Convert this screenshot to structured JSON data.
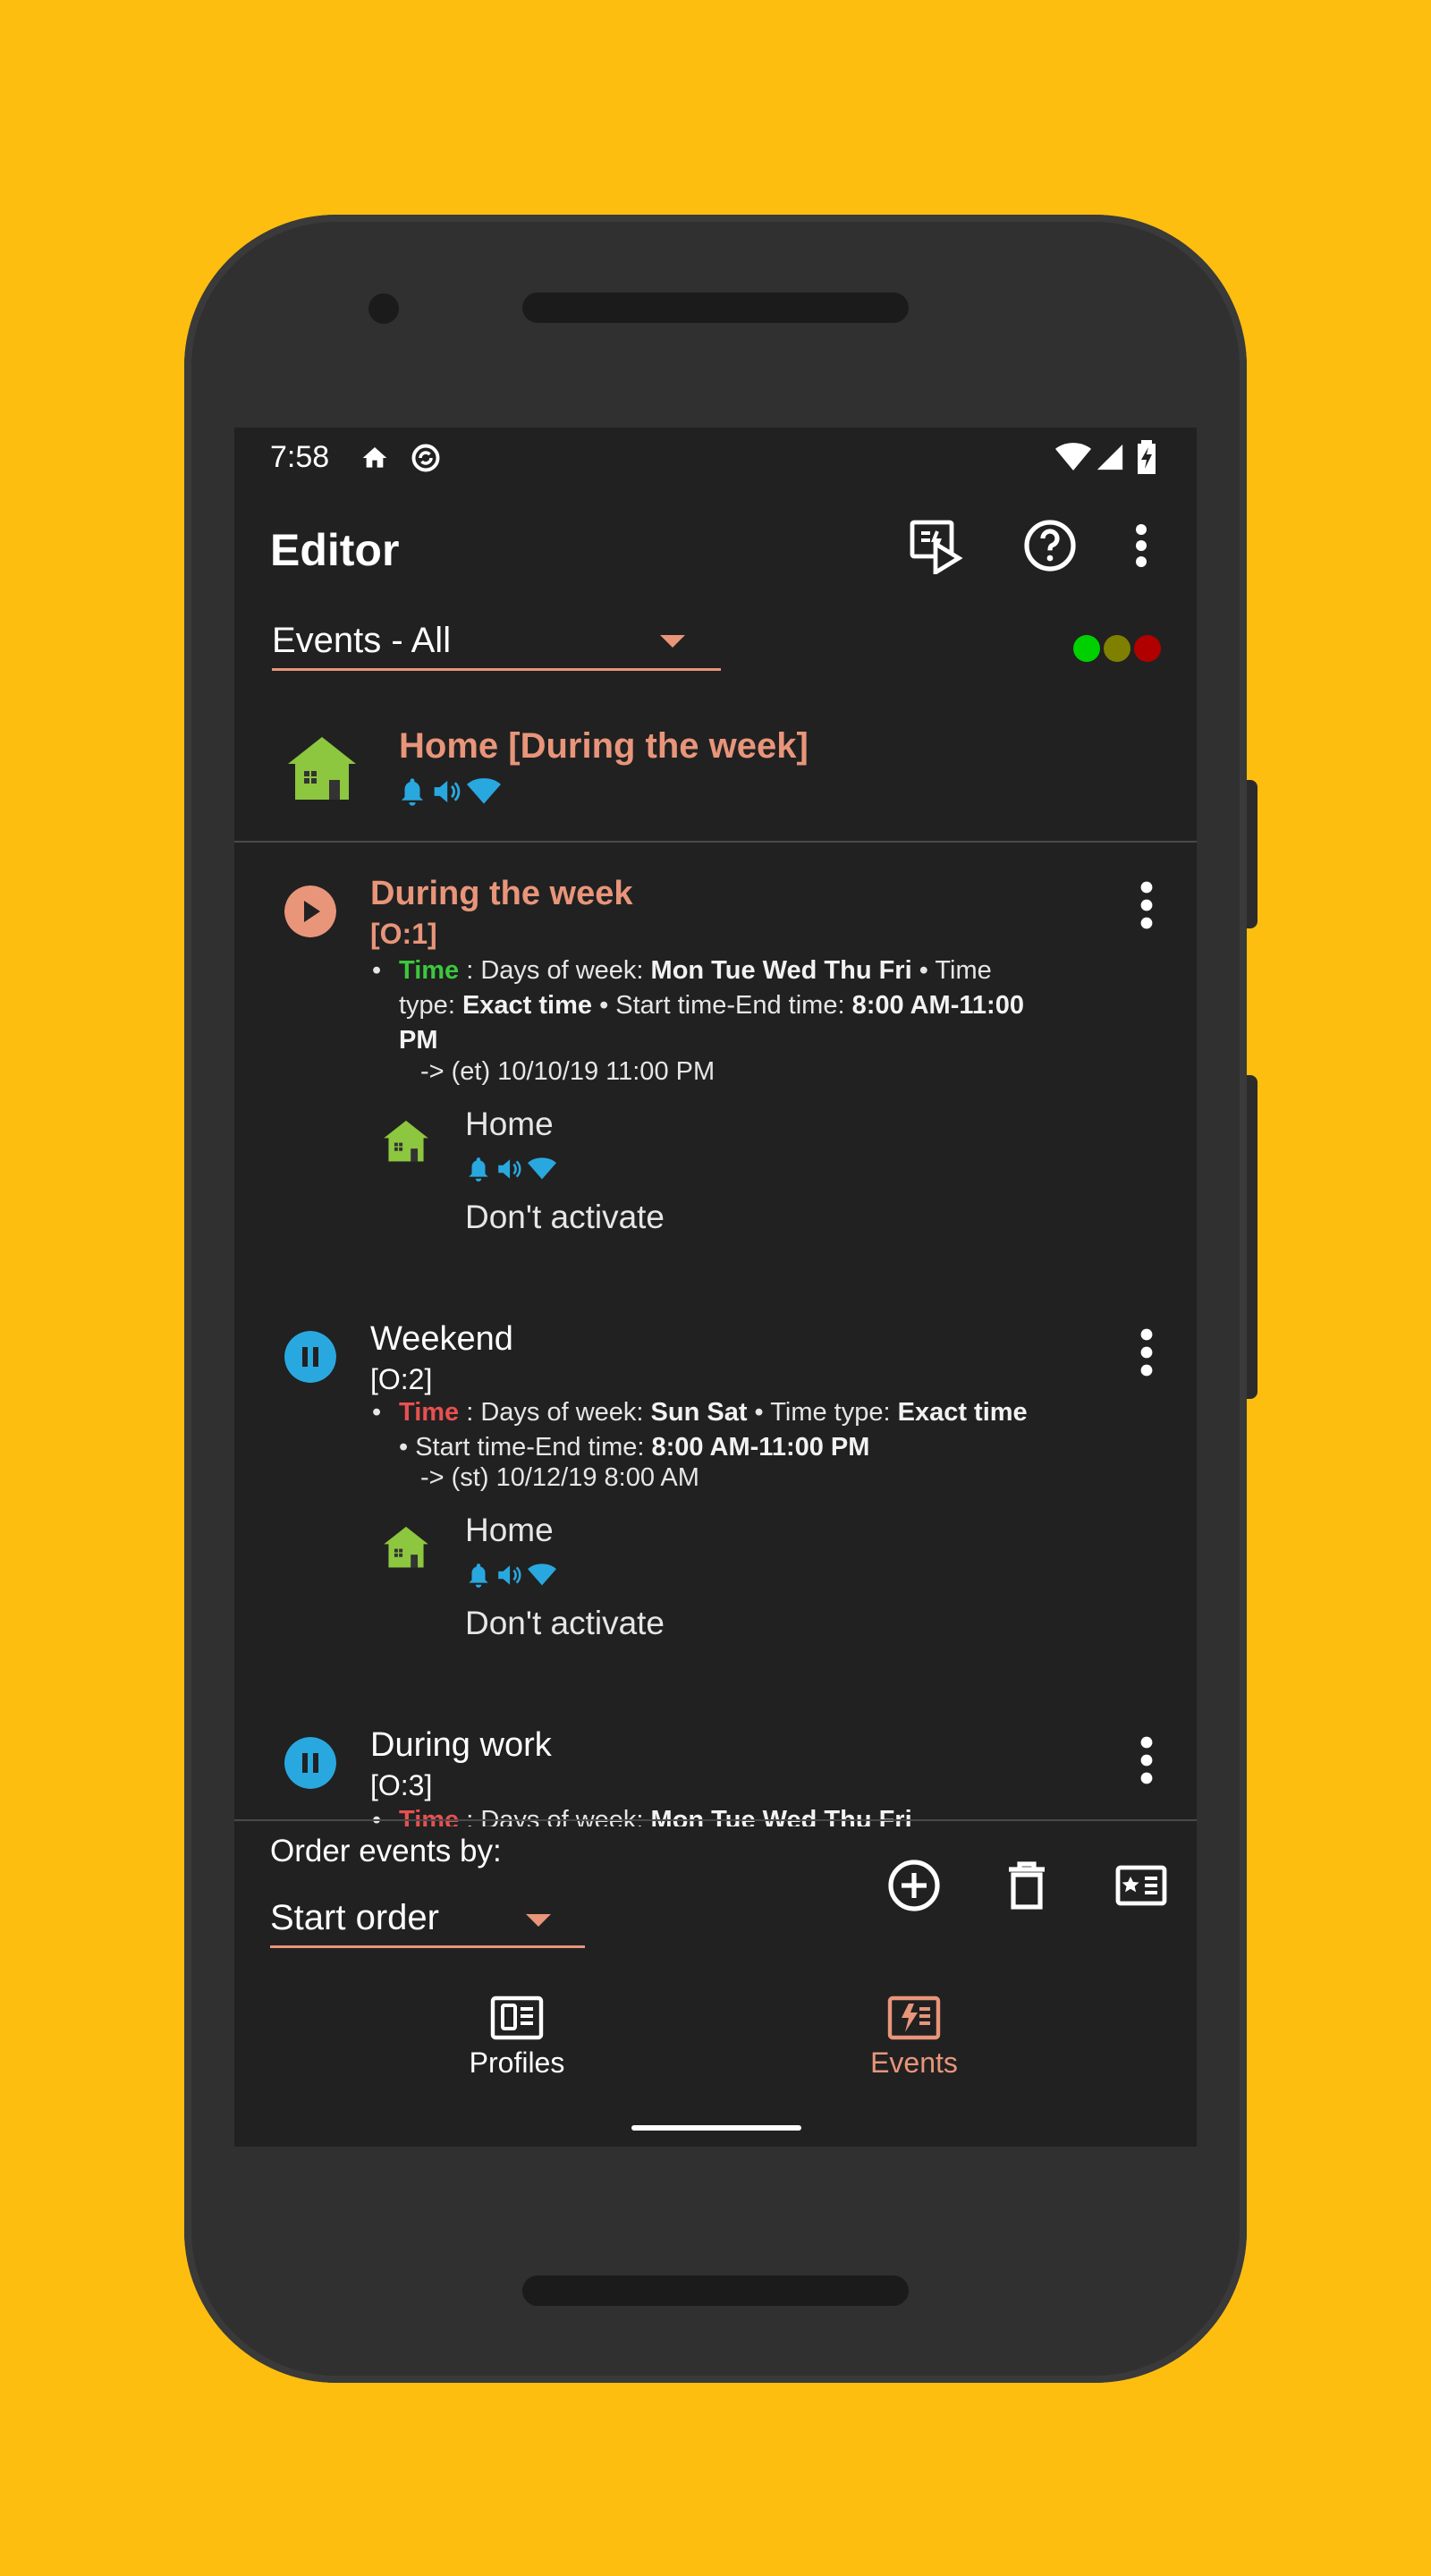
{
  "status_bar": {
    "time": "7:58",
    "left_icons": [
      "home-icon",
      "sync-icon"
    ],
    "right_icons": [
      "wifi-icon",
      "signal-icon",
      "battery-charging-icon"
    ]
  },
  "toolbar": {
    "title": "Editor",
    "actions": [
      "activate-profile-icon",
      "help-icon",
      "more-vert-icon"
    ]
  },
  "filter": {
    "selected": "Events - All"
  },
  "status_dots": {
    "colors": [
      "#00D000",
      "#808000",
      "#B00000"
    ]
  },
  "active_profile": {
    "name": "Home [During the week]"
  },
  "events": [
    {
      "name": "During the week",
      "order": "[O:1]",
      "state": "running",
      "state_color": "#E8957A",
      "name_color": "#E8957A",
      "pref_label": "Time",
      "pref_color": "#3CC83C",
      "desc_parts": {
        "d1": " : Days of week: ",
        "b1": "Mon Tue Wed Thu Fri",
        "d2": " • Time type: ",
        "b2": "Exact time",
        "d3": " • Start time-End time: ",
        "b3": "8:00 AM-11:00 PM"
      },
      "next": "-> (et) 10/10/19 11:00 PM",
      "profile_name": "Home",
      "profile_note": "Don't activate"
    },
    {
      "name": "Weekend",
      "order": "[O:2]",
      "state": "paused",
      "state_color": "#29A8E0",
      "name_color": "#FFFFFF",
      "pref_label": "Time",
      "pref_color": "#E85050",
      "desc_parts": {
        "d1": " : Days of week: ",
        "b1": "Sun Sat",
        "d2": " • Time type: ",
        "b2": "Exact time",
        "d3": " • Start time-End time: ",
        "b3": "8:00 AM-11:00 PM"
      },
      "next": "-> (st) 10/12/19 8:00 AM",
      "profile_name": "Home",
      "profile_note": "Don't activate"
    },
    {
      "name": "During work",
      "order": "[O:3]",
      "state": "paused",
      "state_color": "#29A8E0",
      "name_color": "#FFFFFF",
      "pref_label": "Time",
      "pref_color": "#E85050",
      "desc_parts": {
        "d1": " : Days of week: ",
        "b1": "Mon Tue Wed Thu Fri"
      }
    }
  ],
  "order_panel": {
    "label": "Order events by:",
    "selected": "Start order",
    "actions": [
      "add-circle-icon",
      "delete-icon",
      "profile-card-icon"
    ]
  },
  "bottom_nav": {
    "profiles_label": "Profiles",
    "events_label": "Events",
    "active": "Events",
    "active_color": "#E8957A"
  }
}
